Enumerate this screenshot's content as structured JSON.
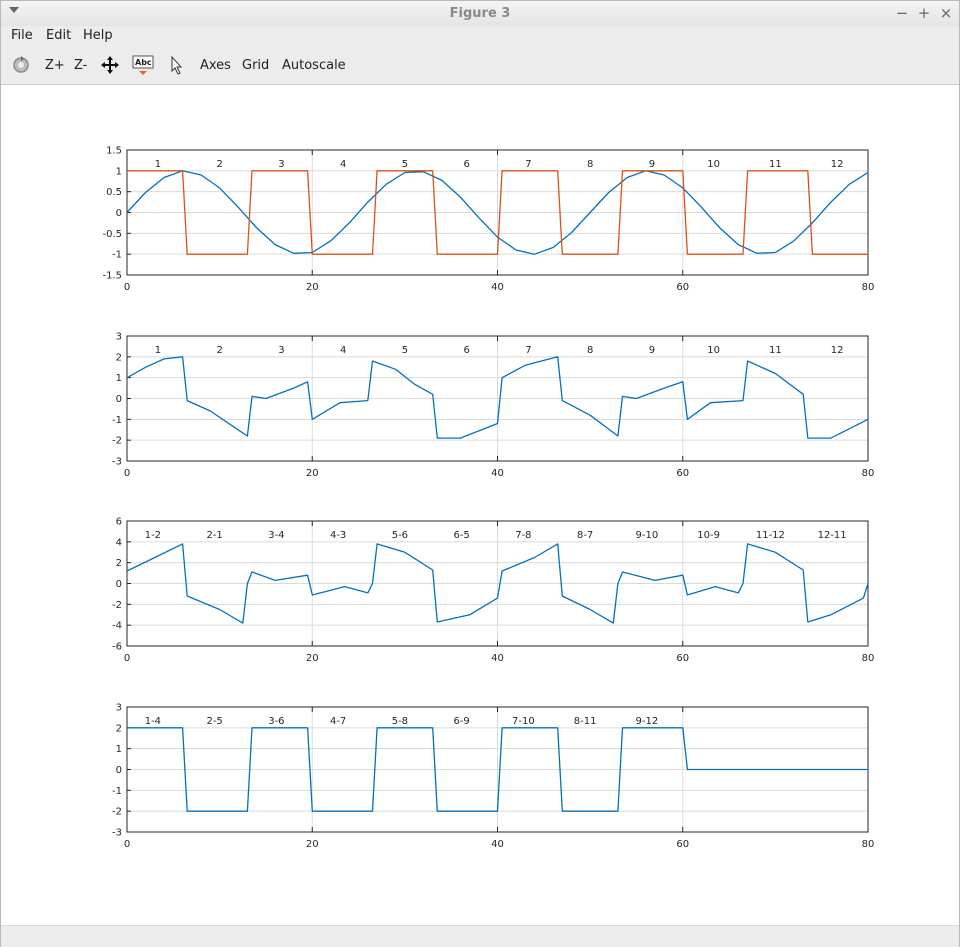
{
  "window": {
    "title": "Figure 3"
  },
  "menu": {
    "file": "File",
    "edit": "Edit",
    "help": "Help"
  },
  "toolbar": {
    "zoom_in": "Z+",
    "zoom_out": "Z-",
    "axes": "Axes",
    "grid": "Grid",
    "autoscale": "Autoscale"
  },
  "colors": {
    "blue": "#0072BD",
    "orange": "#D95319",
    "grid": "#dadada"
  },
  "chart_data": [
    {
      "type": "line",
      "xlim": [
        0,
        80
      ],
      "ylim": [
        -1.5,
        1.5
      ],
      "xticks": [
        "0",
        "20",
        "40",
        "60",
        "80"
      ],
      "yticks": [
        "-1.5",
        "-1",
        "-0.5",
        "0",
        "0.5",
        "1",
        "1.5"
      ],
      "segment_labels": [
        "1",
        "2",
        "3",
        "4",
        "5",
        "6",
        "7",
        "8",
        "9",
        "10",
        "11",
        "12"
      ],
      "series": [
        {
          "color": "blue",
          "x": [
            0,
            2,
            4,
            6,
            8,
            10,
            12,
            14,
            16,
            18,
            20,
            22,
            24,
            26,
            28,
            30,
            32,
            34,
            36,
            38,
            40,
            42,
            44,
            46,
            48,
            50,
            52,
            54,
            56,
            58,
            60,
            62,
            64,
            66,
            68,
            70,
            72,
            74,
            76,
            78,
            80
          ],
          "y": [
            0,
            0.48,
            0.84,
            1,
            0.9,
            0.59,
            0.13,
            -0.37,
            -0.77,
            -0.98,
            -0.96,
            -0.68,
            -0.25,
            0.25,
            0.68,
            0.96,
            0.98,
            0.77,
            0.37,
            -0.13,
            -0.59,
            -0.9,
            -1,
            -0.84,
            -0.48,
            0,
            0.48,
            0.84,
            1,
            0.9,
            0.59,
            0.13,
            -0.37,
            -0.77,
            -0.98,
            -0.96,
            -0.68,
            -0.25,
            0.25,
            0.68,
            0.96
          ]
        },
        {
          "color": "orange",
          "x": [
            0,
            6,
            6.5,
            13,
            13.5,
            19.5,
            20,
            26.5,
            27,
            33,
            33.5,
            40,
            40.5,
            46.5,
            47,
            53,
            53.5,
            60,
            60.5,
            66.5,
            67,
            73.5,
            74,
            80
          ],
          "y": [
            1,
            1,
            -1,
            -1,
            1,
            1,
            -1,
            -1,
            1,
            1,
            -1,
            -1,
            1,
            1,
            -1,
            -1,
            1,
            1,
            -1,
            -1,
            1,
            1,
            -1,
            -1
          ]
        }
      ]
    },
    {
      "type": "line",
      "xlim": [
        0,
        80
      ],
      "ylim": [
        -3,
        3
      ],
      "xticks": [
        "0",
        "20",
        "40",
        "60",
        "80"
      ],
      "yticks": [
        "-3",
        "-2",
        "-1",
        "0",
        "1",
        "2",
        "3"
      ],
      "segment_labels": [
        "1",
        "2",
        "3",
        "4",
        "5",
        "6",
        "7",
        "8",
        "9",
        "10",
        "11",
        "12"
      ],
      "series": [
        {
          "color": "blue",
          "x": [
            0,
            2,
            4,
            6,
            6.5,
            9,
            12,
            13,
            13.5,
            15,
            18,
            19.5,
            20,
            23,
            26,
            26.5,
            29,
            31,
            33,
            33.5,
            36,
            40,
            40.5,
            43,
            46.5,
            47,
            50,
            53,
            53.5,
            55,
            58,
            60,
            60.5,
            63,
            66.5,
            67,
            70,
            73,
            73.5,
            76,
            80
          ],
          "y": [
            1,
            1.5,
            1.9,
            2,
            -0.1,
            -0.6,
            -1.5,
            -1.8,
            0.1,
            0,
            0.5,
            0.8,
            -1,
            -0.2,
            -0.1,
            1.8,
            1.4,
            0.7,
            0.2,
            -1.9,
            -1.9,
            -1.2,
            1,
            1.6,
            2,
            -0.1,
            -0.8,
            -1.8,
            0.1,
            0,
            0.5,
            0.8,
            -1,
            -0.2,
            -0.1,
            1.8,
            1.2,
            0.2,
            -1.9,
            -1.9,
            -1
          ]
        }
      ]
    },
    {
      "type": "line",
      "xlim": [
        0,
        80
      ],
      "ylim": [
        -6,
        6
      ],
      "xticks": [
        "0",
        "20",
        "40",
        "60",
        "80"
      ],
      "yticks": [
        "-6",
        "-4",
        "-2",
        "0",
        "2",
        "4",
        "6"
      ],
      "segment_labels": [
        "1-2",
        "2-1",
        "3-4",
        "4-3",
        "5-6",
        "6-5",
        "7-8",
        "8-7",
        "9-10",
        "10-9",
        "11-12",
        "12-11"
      ],
      "series": [
        {
          "color": "blue",
          "x": [
            0,
            3,
            6,
            6.5,
            10,
            12.5,
            13,
            13.5,
            16,
            19.5,
            20,
            23.5,
            26,
            26.5,
            27,
            30,
            33,
            33.5,
            37,
            40,
            40.5,
            44,
            46.5,
            47,
            50,
            52.5,
            53,
            53.5,
            57,
            60,
            60.5,
            63.5,
            66,
            66.5,
            67,
            70,
            73,
            73.5,
            76,
            79.5,
            80
          ],
          "y": [
            1.2,
            2.5,
            3.8,
            -1.2,
            -2.5,
            -3.8,
            0,
            1.1,
            0.3,
            0.8,
            -1.1,
            -0.3,
            -0.9,
            0,
            3.8,
            3,
            1.3,
            -3.7,
            -3,
            -1.4,
            1.2,
            2.5,
            3.8,
            -1.2,
            -2.5,
            -3.8,
            0,
            1.1,
            0.3,
            0.8,
            -1.1,
            -0.3,
            -0.9,
            0,
            3.8,
            3,
            1.3,
            -3.7,
            -3,
            -1.4,
            0
          ]
        }
      ]
    },
    {
      "type": "line",
      "xlim": [
        0,
        80
      ],
      "ylim": [
        -3,
        3
      ],
      "xticks": [
        "0",
        "20",
        "40",
        "60",
        "80"
      ],
      "yticks": [
        "-3",
        "-2",
        "-1",
        "0",
        "1",
        "2",
        "3"
      ],
      "segment_labels": [
        "1-4",
        "2-5",
        "3-6",
        "4-7",
        "5-8",
        "6-9",
        "7-10",
        "8-11",
        "9-12"
      ],
      "series": [
        {
          "color": "blue",
          "x": [
            0,
            6,
            6.5,
            13,
            13.5,
            19.5,
            20,
            26.5,
            27,
            33,
            33.5,
            40,
            40.5,
            46.5,
            47,
            53,
            53.5,
            60,
            60.5,
            80
          ],
          "y": [
            2,
            2,
            -2,
            -2,
            2,
            2,
            -2,
            -2,
            2,
            2,
            -2,
            -2,
            2,
            2,
            -2,
            -2,
            2,
            2,
            0,
            0
          ]
        }
      ]
    }
  ]
}
